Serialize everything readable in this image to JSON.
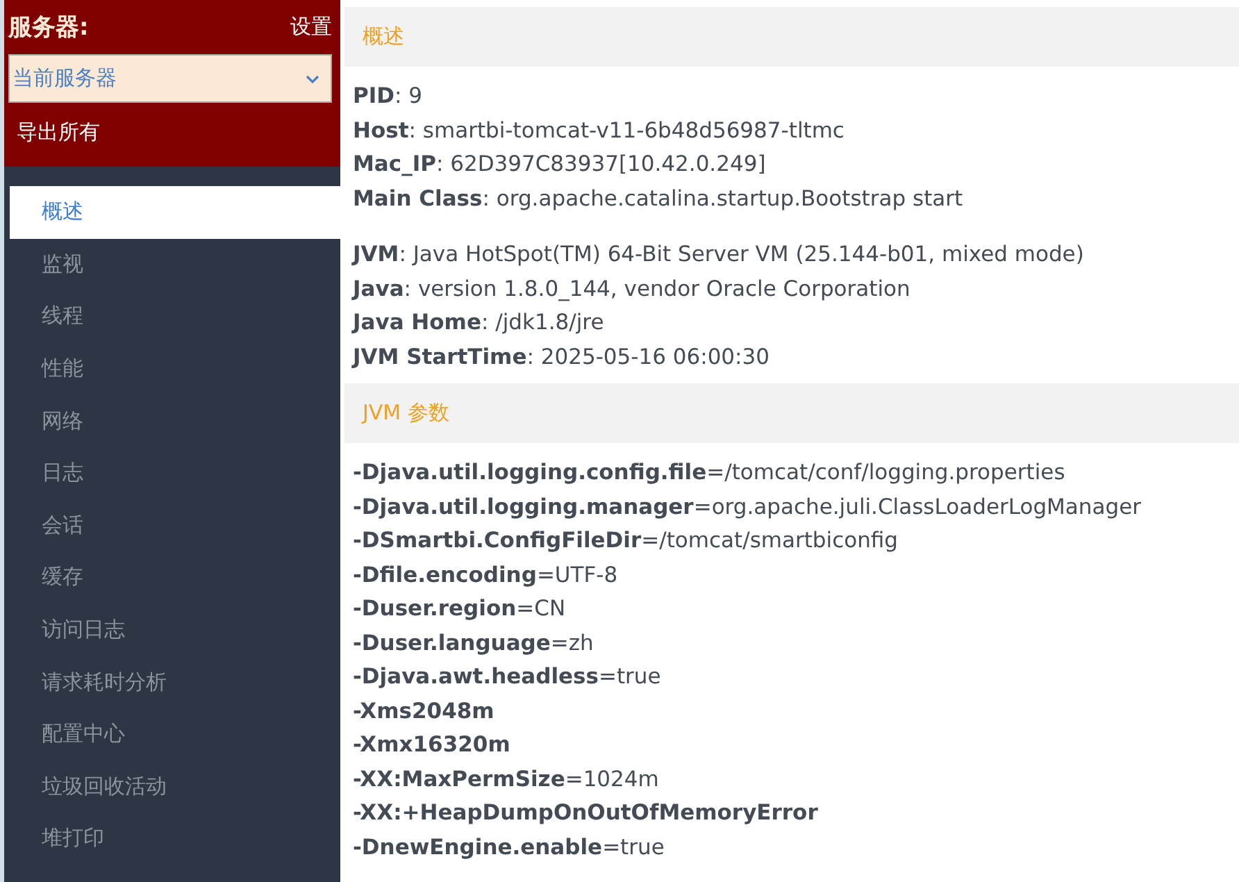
{
  "server_panel": {
    "title": "服务器:",
    "settings_link": "设置",
    "server_select": {
      "value": "当前服务器"
    },
    "export_all": "导出所有"
  },
  "nav": [
    {
      "label": "概述",
      "selected": true
    },
    {
      "label": "监视",
      "selected": false
    },
    {
      "label": "线程",
      "selected": false
    },
    {
      "label": "性能",
      "selected": false
    },
    {
      "label": "网络",
      "selected": false
    },
    {
      "label": "日志",
      "selected": false
    },
    {
      "label": "会话",
      "selected": false
    },
    {
      "label": "缓存",
      "selected": false
    },
    {
      "label": "访问日志",
      "selected": false
    },
    {
      "label": "请求耗时分析",
      "selected": false
    },
    {
      "label": "配置中心",
      "selected": false
    },
    {
      "label": "垃圾回收活动",
      "selected": false
    },
    {
      "label": "堆打印",
      "selected": false
    }
  ],
  "sections": [
    {
      "title": "概述",
      "groups": [
        [
          {
            "key": "PID",
            "value": ": 9"
          },
          {
            "key": "Host",
            "value": ": smartbi-tomcat-v11-6b48d56987-tltmc"
          },
          {
            "key": "Mac_IP",
            "value": ": 62D397C83937[10.42.0.249]"
          },
          {
            "key": "Main Class",
            "value": ": org.apache.catalina.startup.Bootstrap start"
          }
        ],
        [
          {
            "key": "JVM",
            "value": ": Java HotSpot(TM) 64-Bit Server VM (25.144-b01, mixed mode)"
          },
          {
            "key": "Java",
            "value": ": version 1.8.0_144, vendor Oracle Corporation"
          },
          {
            "key": "Java Home",
            "value": ": /jdk1.8/jre"
          },
          {
            "key": "JVM StartTime",
            "value": ": 2025-05-16 06:00:30"
          }
        ]
      ]
    },
    {
      "title": "JVM 参数",
      "groups": [
        [
          {
            "key": "-Djava.util.logging.config.file",
            "value": "=/tomcat/conf/logging.properties"
          },
          {
            "key": "-Djava.util.logging.manager",
            "value": "=org.apache.juli.ClassLoaderLogManager"
          },
          {
            "key": "-DSmartbi.ConfigFileDir",
            "value": "=/tomcat/smartbiconfig"
          },
          {
            "key": "-Dfile.encoding",
            "value": "=UTF-8"
          },
          {
            "key": "-Duser.region",
            "value": "=CN"
          },
          {
            "key": "-Duser.language",
            "value": "=zh"
          },
          {
            "key": "-Djava.awt.headless",
            "value": "=true"
          },
          {
            "key": "-Xms2048m"
          },
          {
            "key": "-Xmx16320m"
          },
          {
            "key": "-XX:MaxPermSize",
            "value": "=1024m"
          },
          {
            "key": "-XX:+HeapDumpOnOutOfMemoryError"
          },
          {
            "key": "-DnewEngine.enable",
            "value": "=true"
          }
        ]
      ]
    }
  ]
}
